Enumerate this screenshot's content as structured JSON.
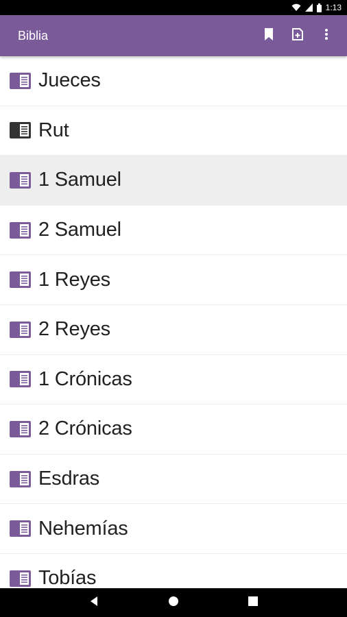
{
  "status_bar": {
    "time": "1:13",
    "icons": [
      "wifi-icon",
      "signal-icon",
      "battery-icon"
    ]
  },
  "app_bar": {
    "title": "Biblia",
    "actions": [
      {
        "name": "bookmark-icon"
      },
      {
        "name": "add-note-icon"
      },
      {
        "name": "overflow-menu-icon"
      }
    ],
    "color": "#7b5a9a"
  },
  "book_list": {
    "selected_index": 2,
    "items": [
      {
        "label": "Jueces",
        "icon_color": "#7b5a9a"
      },
      {
        "label": "Rut",
        "icon_color": "#333333"
      },
      {
        "label": "1 Samuel",
        "icon_color": "#7b5a9a"
      },
      {
        "label": "2 Samuel",
        "icon_color": "#7b5a9a"
      },
      {
        "label": "1 Reyes",
        "icon_color": "#7b5a9a"
      },
      {
        "label": "2 Reyes",
        "icon_color": "#7b5a9a"
      },
      {
        "label": "1 Crónicas",
        "icon_color": "#7b5a9a"
      },
      {
        "label": "2 Crónicas",
        "icon_color": "#7b5a9a"
      },
      {
        "label": "Esdras",
        "icon_color": "#7b5a9a"
      },
      {
        "label": "Nehemías",
        "icon_color": "#7b5a9a"
      },
      {
        "label": "Tobías",
        "icon_color": "#7b5a9a"
      }
    ]
  },
  "nav_bar": {
    "buttons": [
      "back-icon",
      "home-icon",
      "recents-icon"
    ]
  }
}
